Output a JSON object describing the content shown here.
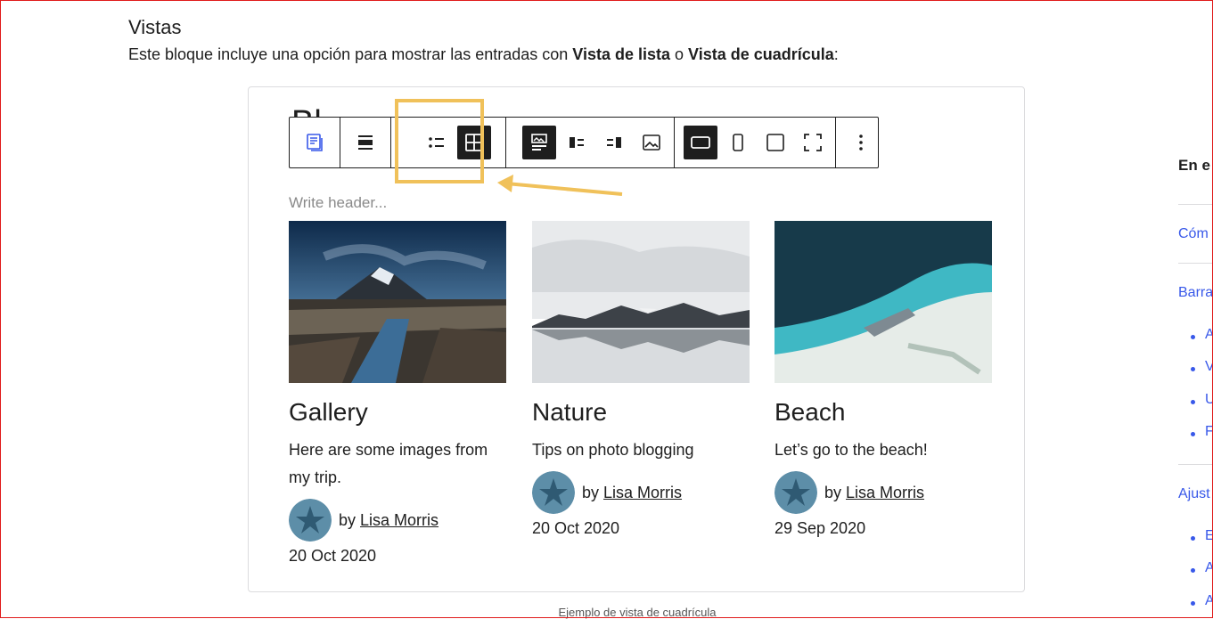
{
  "section": {
    "heading": "Vistas",
    "intro_prefix": "Este bloque incluye una opción para mostrar las entradas con ",
    "intro_bold1": "Vista de lista",
    "intro_mid": " o ",
    "intro_bold2": "Vista de cuadrícula",
    "intro_suffix": ":"
  },
  "editor": {
    "ghost_title": "Bl",
    "header_placeholder": "Write header...",
    "toolbar_icons": [
      "block-type-icon",
      "align-icon",
      "list-view-icon",
      "grid-view-icon",
      "media-text-icon",
      "image-left-icon",
      "image-right-icon",
      "image-icon",
      "landscape-icon",
      "portrait-icon",
      "square-icon",
      "fullscreen-icon",
      "more-options-icon"
    ],
    "highlight_color": "#f0c15a"
  },
  "posts": [
    {
      "title": "Gallery",
      "excerpt": "Here are some images from my trip.",
      "by": "by",
      "author": "Lisa Morris",
      "date": "20 Oct 2020"
    },
    {
      "title": "Nature",
      "excerpt": "Tips on photo blogging",
      "by": "by",
      "author": "Lisa Morris",
      "date": "20 Oct 2020"
    },
    {
      "title": "Beach",
      "excerpt": "Let’s go to the beach!",
      "by": "by",
      "author": "Lisa Morris",
      "date": "29 Sep 2020"
    }
  ],
  "caption": "Ejemplo de vista de cuadrícula",
  "toc": {
    "title": "En e",
    "links": [
      "Cóm",
      "Barra",
      "Ajust"
    ],
    "sub_items_1": [
      "A",
      "V",
      "U",
      "F"
    ],
    "sub_items_2": [
      "E",
      "A",
      "A"
    ],
    "link_color": "#3858e9"
  }
}
